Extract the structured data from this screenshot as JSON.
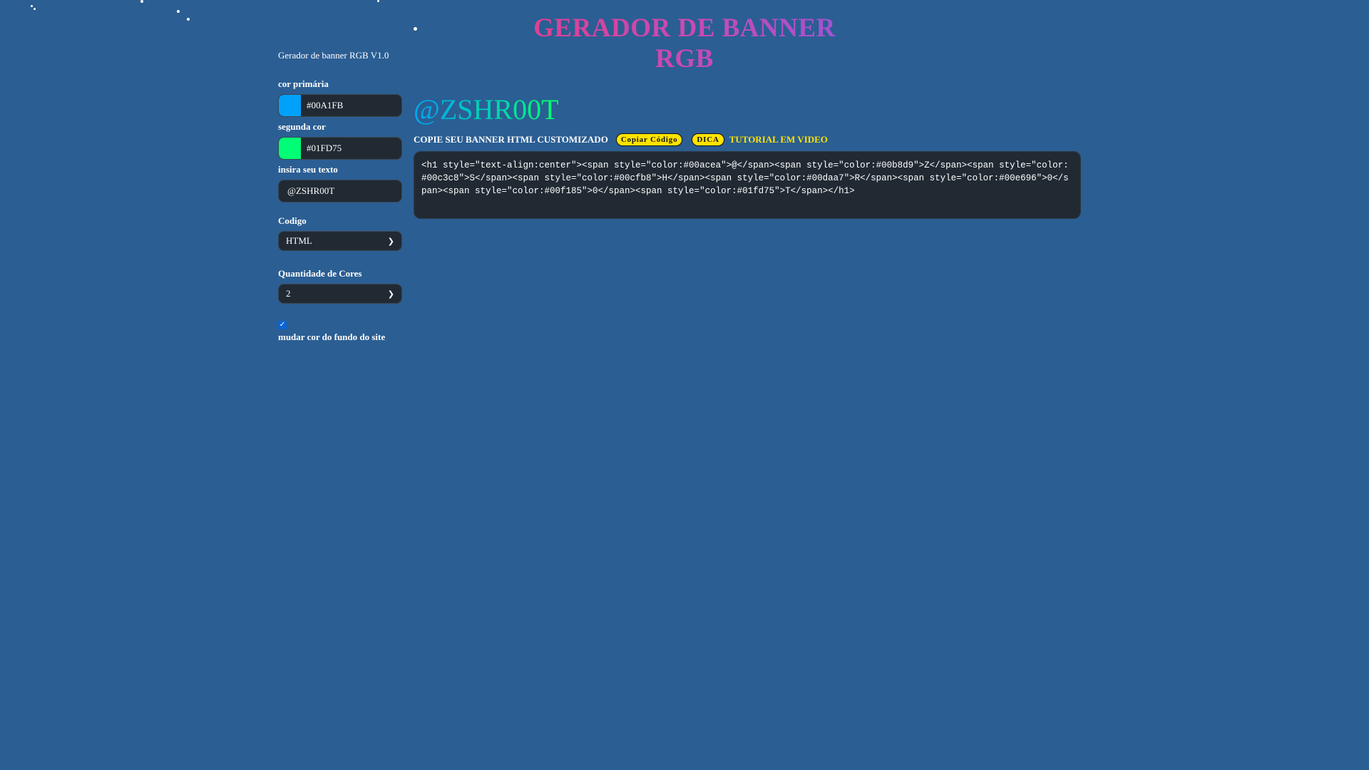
{
  "header": {
    "title": "GERADOR DE BANNER RGB"
  },
  "sidebar": {
    "version": "Gerador de banner RGB V1.0",
    "primary_color": {
      "label": "cor primária",
      "value": "#00A1FB",
      "swatch": "#00A1FB"
    },
    "secondary_color": {
      "label": "segunda cor",
      "value": "#01FD75",
      "swatch": "#01FD75"
    },
    "text_input": {
      "label": "insira seu texto",
      "value": "@ZSHR00T"
    },
    "code_select": {
      "label": "Codigo",
      "value": "HTML"
    },
    "colors_select": {
      "label": "Quantidade de Cores",
      "value": "2"
    },
    "background_toggle": {
      "label": "mudar cor do fundo do site",
      "checked": true
    }
  },
  "main": {
    "preview_chars": [
      {
        "char": "@",
        "color": "#00acea"
      },
      {
        "char": "Z",
        "color": "#00b8d9"
      },
      {
        "char": "S",
        "color": "#00c3c8"
      },
      {
        "char": "H",
        "color": "#00cfb8"
      },
      {
        "char": "R",
        "color": "#00daa7"
      },
      {
        "char": "0",
        "color": "#00e696"
      },
      {
        "char": "0",
        "color": "#00f185"
      },
      {
        "char": "T",
        "color": "#01fd75"
      }
    ],
    "copy_heading": "COPIE SEU BANNER HTML CUSTOMIZADO",
    "copy_button": "Copiar Código",
    "tip_button": "DICA",
    "tutorial_link": "TUTORIAL EM VIDEO",
    "code": "<h1 style=\"text-align:center\"><span style=\"color:#00acea\">@</span><span style=\"color:#00b8d9\">Z</span><span style=\"color:#00c3c8\">S</span><span style=\"color:#00cfb8\">H</span><span style=\"color:#00daa7\">R</span><span style=\"color:#00e696\">0</span><span style=\"color:#00f185\">0</span><span style=\"color:#01fd75\">T</span></h1>"
  },
  "colors": {
    "background": "#2b5e93",
    "field_bg": "#212a33",
    "accent_yellow": "#ffe300",
    "checkbox_blue": "#0b63d6"
  }
}
